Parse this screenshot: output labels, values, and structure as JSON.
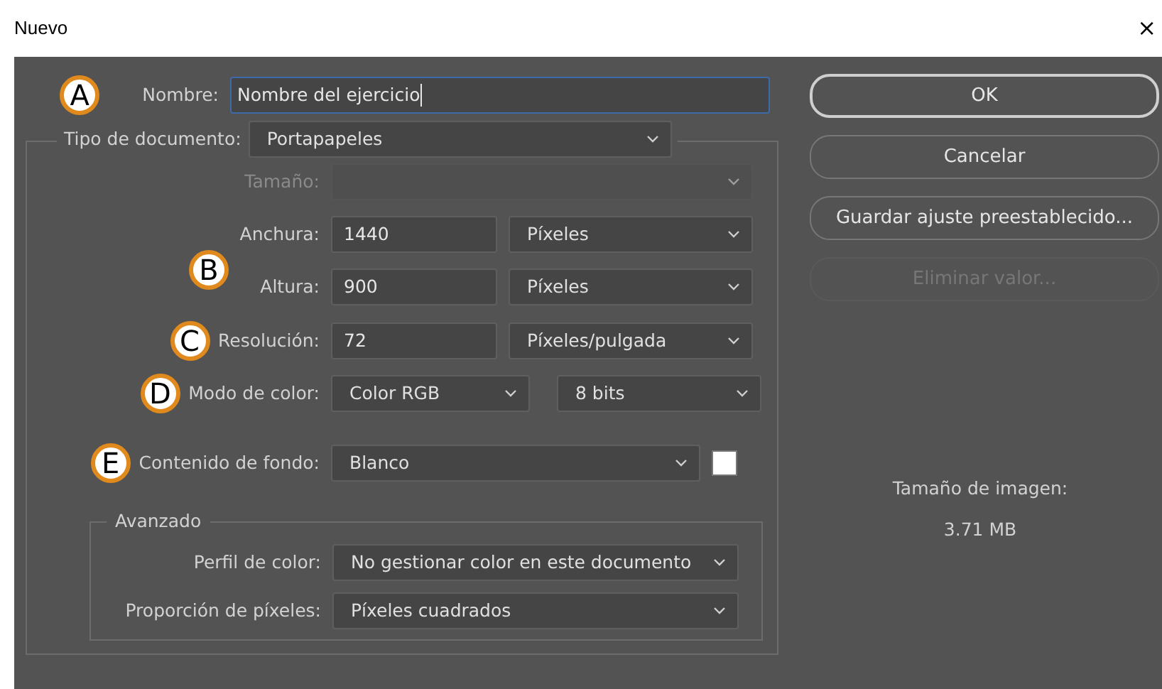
{
  "window": {
    "title": "Nuevo",
    "close": "×"
  },
  "name_field": {
    "marker": "A",
    "label": "Nombre:",
    "value": "Nombre del ejercicio",
    "focused": true
  },
  "document_type": {
    "label": "Tipo de documento:",
    "value": "Portapapeles"
  },
  "size": {
    "label": "Tamaño:",
    "disabled": true
  },
  "dimensions": {
    "marker": "B",
    "width": {
      "label": "Anchura:",
      "value": "1440",
      "unit": "Píxeles"
    },
    "height": {
      "label": "Altura:",
      "value": "900",
      "unit": "Píxeles"
    }
  },
  "resolution": {
    "marker": "C",
    "label": "Resolución:",
    "value": "72",
    "unit": "Píxeles/pulgada"
  },
  "color_mode": {
    "marker": "D",
    "label": "Modo de color:",
    "value": "Color RGB",
    "depth": "8 bits"
  },
  "background": {
    "marker": "E",
    "label": "Contenido de fondo:",
    "value": "Blanco",
    "color": "#ffffff"
  },
  "advanced": {
    "title": "Avanzado",
    "color_profile": {
      "label": "Perfil de color:",
      "value": "No gestionar color en este documento"
    },
    "pixel_aspect": {
      "label": "Proporción de píxeles:",
      "value": "Píxeles cuadrados"
    }
  },
  "buttons": [
    {
      "label": "OK",
      "default": true,
      "disabled": false
    },
    {
      "label": "Cancelar",
      "default": false,
      "disabled": false
    },
    {
      "label": "Guardar ajuste preestablecido...",
      "default": false,
      "disabled": false
    },
    {
      "label": "Eliminar valor...",
      "default": false,
      "disabled": true
    }
  ],
  "image_size": {
    "label": "Tamaño de imagen:",
    "value": "3.71 MB"
  }
}
